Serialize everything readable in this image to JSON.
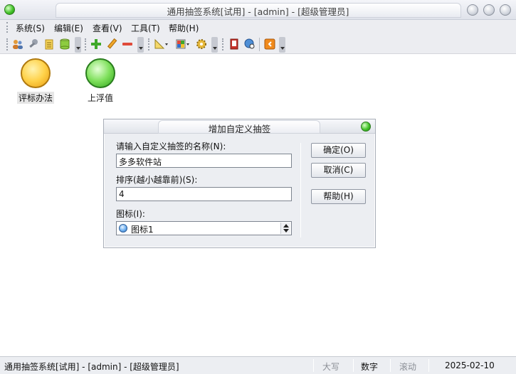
{
  "window": {
    "title": "通用抽签系统[试用] - [admin] - [超级管理员]",
    "accent": "#44c32a"
  },
  "menu": {
    "items": [
      {
        "label": "系统(S)"
      },
      {
        "label": "编辑(E)"
      },
      {
        "label": "查看(V)"
      },
      {
        "label": "工具(T)"
      },
      {
        "label": "帮助(H)"
      }
    ]
  },
  "toolbar": {
    "icons": [
      "users-icon",
      "key-icon",
      "notepad-icon",
      "database-icon",
      "add-icon",
      "edit-pencil-icon",
      "remove-icon",
      "ruler-icon",
      "color-palette-icon",
      "gear-icon",
      "book-icon",
      "globe-search-icon",
      "exit-icon"
    ]
  },
  "desktop": {
    "items": [
      {
        "label": "评标办法",
        "color": "#ffd24a"
      },
      {
        "label": "上浮值",
        "color": "#7fe05c"
      }
    ]
  },
  "dialog": {
    "title": "增加自定义抽签",
    "name_label": "请输入自定义抽签的名称(N):",
    "name_value": "多多软件站",
    "order_label": "排序(越小越靠前)(S):",
    "order_value": "4",
    "icon_label": "图标(I):",
    "icon_value": "图标1",
    "ok_label": "确定(O)",
    "cancel_label": "取消(C)",
    "help_label": "帮助(H)"
  },
  "status": {
    "text": "通用抽签系统[试用] - [admin] - [超级管理员]",
    "caps": "大写",
    "num": "数字",
    "scroll": "滚动",
    "date": "2025-02-10"
  }
}
